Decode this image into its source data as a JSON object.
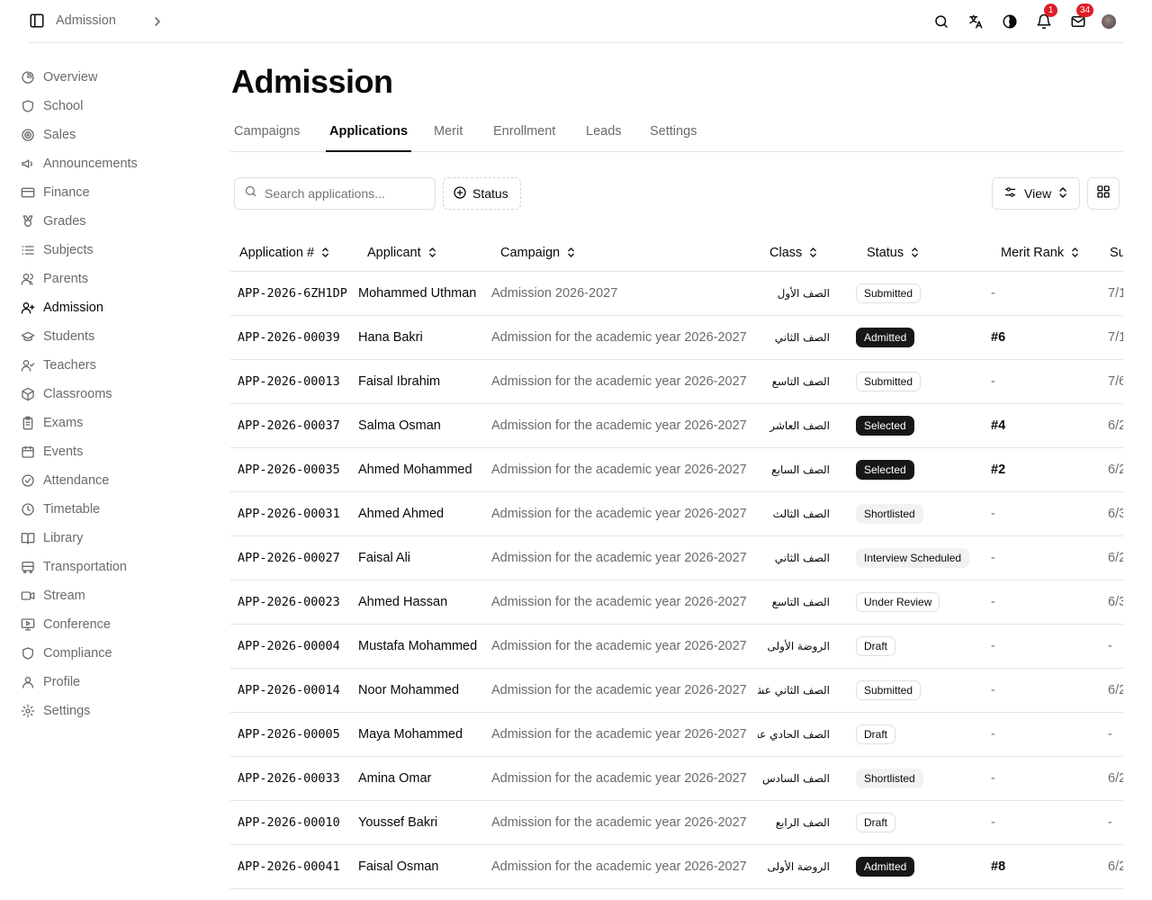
{
  "header": {
    "breadcrumb": "Admission",
    "notifications_count": "1",
    "mail_count": "34"
  },
  "sidebar": {
    "items": [
      {
        "label": "Overview",
        "icon": "pie-chart-icon"
      },
      {
        "label": "School",
        "icon": "shield-icon"
      },
      {
        "label": "Sales",
        "icon": "target-icon"
      },
      {
        "label": "Announcements",
        "icon": "megaphone-icon"
      },
      {
        "label": "Finance",
        "icon": "credit-card-icon"
      },
      {
        "label": "Grades",
        "icon": "medal-icon"
      },
      {
        "label": "Subjects",
        "icon": "list-icon"
      },
      {
        "label": "Parents",
        "icon": "users-icon"
      },
      {
        "label": "Admission",
        "icon": "user-plus-icon"
      },
      {
        "label": "Students",
        "icon": "graduation-cap-icon"
      },
      {
        "label": "Teachers",
        "icon": "user-check-icon"
      },
      {
        "label": "Classrooms",
        "icon": "box-icon"
      },
      {
        "label": "Exams",
        "icon": "clipboard-icon"
      },
      {
        "label": "Events",
        "icon": "calendar-icon"
      },
      {
        "label": "Attendance",
        "icon": "check-circle-icon"
      },
      {
        "label": "Timetable",
        "icon": "clock-icon"
      },
      {
        "label": "Library",
        "icon": "book-open-icon"
      },
      {
        "label": "Transportation",
        "icon": "bus-icon"
      },
      {
        "label": "Stream",
        "icon": "video-icon"
      },
      {
        "label": "Conference",
        "icon": "monitor-play-icon"
      },
      {
        "label": "Compliance",
        "icon": "shield-icon"
      },
      {
        "label": "Profile",
        "icon": "user-icon"
      },
      {
        "label": "Settings",
        "icon": "gear-icon"
      }
    ]
  },
  "page": {
    "title": "Admission"
  },
  "tabs": [
    "Campaigns",
    "Applications",
    "Merit",
    "Enrollment",
    "Leads",
    "Settings"
  ],
  "toolbar": {
    "search_placeholder": "Search applications...",
    "status_filter": "Status",
    "view_label": "View"
  },
  "table": {
    "columns": [
      "Application #",
      "Applicant",
      "Campaign",
      "Class",
      "Status",
      "Merit Rank",
      "Su"
    ],
    "rows": [
      {
        "app": "APP-2026-6ZH1DP",
        "name": "Mohammed Uthman",
        "campaign": "Admission 2026-2027",
        "class": "الصف الأول",
        "status": "Submitted",
        "status_style": "outline",
        "merit": "-",
        "sub": "7/1"
      },
      {
        "app": "APP-2026-00039",
        "name": "Hana Bakri",
        "campaign": "Admission for the academic year 2026-2027",
        "class": "الصف الثاني",
        "status": "Admitted",
        "status_style": "solid",
        "merit": "#6",
        "sub": "7/1"
      },
      {
        "app": "APP-2026-00013",
        "name": "Faisal Ibrahim",
        "campaign": "Admission for the academic year 2026-2027",
        "class": "الصف التاسع",
        "status": "Submitted",
        "status_style": "outline",
        "merit": "-",
        "sub": "7/6"
      },
      {
        "app": "APP-2026-00037",
        "name": "Salma Osman",
        "campaign": "Admission for the academic year 2026-2027",
        "class": "الصف العاشر",
        "status": "Selected",
        "status_style": "solid",
        "merit": "#4",
        "sub": "6/2"
      },
      {
        "app": "APP-2026-00035",
        "name": "Ahmed Mohammed",
        "campaign": "Admission for the academic year 2026-2027",
        "class": "الصف السابع",
        "status": "Selected",
        "status_style": "solid",
        "merit": "#2",
        "sub": "6/2"
      },
      {
        "app": "APP-2026-00031",
        "name": "Ahmed Ahmed",
        "campaign": "Admission for the academic year 2026-2027",
        "class": "الصف الثالث",
        "status": "Shortlisted",
        "status_style": "muted",
        "merit": "-",
        "sub": "6/3"
      },
      {
        "app": "APP-2026-00027",
        "name": "Faisal Ali",
        "campaign": "Admission for the academic year 2026-2027",
        "class": "الصف الثاني",
        "status": "Interview Scheduled",
        "status_style": "muted",
        "merit": "-",
        "sub": "6/2"
      },
      {
        "app": "APP-2026-00023",
        "name": "Ahmed Hassan",
        "campaign": "Admission for the academic year 2026-2027",
        "class": "الصف التاسع",
        "status": "Under Review",
        "status_style": "outline",
        "merit": "-",
        "sub": "6/3"
      },
      {
        "app": "APP-2026-00004",
        "name": "Mustafa Mohammed",
        "campaign": "Admission for the academic year 2026-2027",
        "class": "الروضة الأولى",
        "status": "Draft",
        "status_style": "outline",
        "merit": "-",
        "sub": "-"
      },
      {
        "app": "APP-2026-00014",
        "name": "Noor Mohammed",
        "campaign": "Admission for the academic year 2026-2027",
        "class": "الصف الثاني عشر",
        "status": "Submitted",
        "status_style": "outline",
        "merit": "-",
        "sub": "6/2"
      },
      {
        "app": "APP-2026-00005",
        "name": "Maya Mohammed",
        "campaign": "Admission for the academic year 2026-2027",
        "class": "الصف الحادي عشر",
        "status": "Draft",
        "status_style": "outline",
        "merit": "-",
        "sub": "-"
      },
      {
        "app": "APP-2026-00033",
        "name": "Amina Omar",
        "campaign": "Admission for the academic year 2026-2027",
        "class": "الصف السادس",
        "status": "Shortlisted",
        "status_style": "muted",
        "merit": "-",
        "sub": "6/2"
      },
      {
        "app": "APP-2026-00010",
        "name": "Youssef Bakri",
        "campaign": "Admission for the academic year 2026-2027",
        "class": "الصف الرابع",
        "status": "Draft",
        "status_style": "outline",
        "merit": "-",
        "sub": "-"
      },
      {
        "app": "APP-2026-00041",
        "name": "Faisal Osman",
        "campaign": "Admission for the academic year 2026-2027",
        "class": "الروضة الأولى",
        "status": "Admitted",
        "status_style": "solid",
        "merit": "#8",
        "sub": "6/2"
      }
    ]
  },
  "colors": {
    "text": "#0a0a0a",
    "muted_text": "#6b6b6b",
    "border": "#e5e5e5",
    "badge_red": "#e11d27",
    "pill_dark": "#171717",
    "pill_muted": "#f2f2f2"
  }
}
